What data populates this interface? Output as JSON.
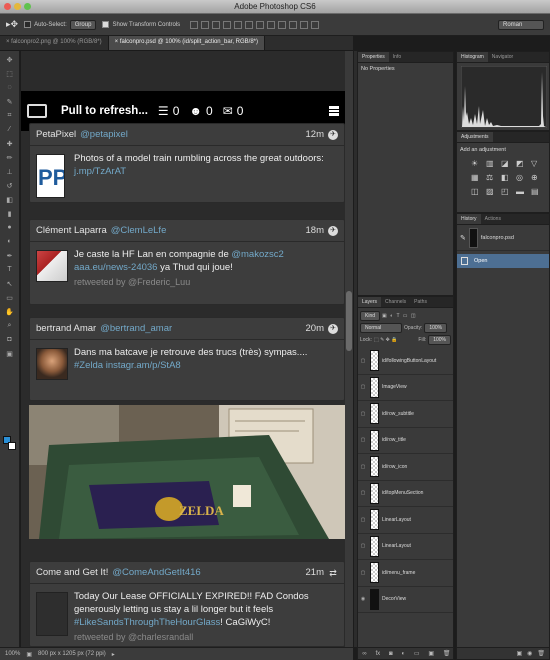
{
  "window": {
    "title": "Adobe Photoshop CS6"
  },
  "options_bar": {
    "auto_select_label": "Auto-Select:",
    "auto_select_value": "Group",
    "show_transform_label": "Show Transform Controls",
    "workspace": "Roman"
  },
  "doc_tabs": [
    "falconpro2.png @ 100% (RGB/8*)",
    "falconpro.psd @ 100% (id/split_action_bar, RGB/8*)"
  ],
  "app": {
    "header": {
      "title": "Pull to refresh...",
      "count1": "0",
      "count2": "0",
      "count3": "0"
    },
    "tweets": [
      {
        "name": "PetaPixel",
        "handle": "@petapixel",
        "time": "12m",
        "text": "Photos of a model train rumbling across the great outdoors:",
        "link": "j.mp/TzArAT",
        "retweet": ""
      },
      {
        "name": "Clément Laparra",
        "handle": "@ClemLeLfe",
        "time": "18m",
        "text_pre": "Je caste la HF Lan en compagnie de",
        "mention": "@makozsc2",
        "link": "aaa.eu/news-24036",
        "text_post": "ya Thud qui joue!",
        "retweet": "retweeted by @Frederic_Luu"
      },
      {
        "name": "bertrand Amar",
        "handle": "@bertrand_amar",
        "time": "20m",
        "text": "Dans ma batcave je retrouve des trucs (très) sympas....",
        "hashtag": "#Zelda",
        "link": "instagr.am/p/StA8",
        "retweet": ""
      },
      {
        "name": "Come and Get It!",
        "handle": "@ComeAndGetIt416",
        "time": "21m",
        "text_a": "Today Our Lease OFFICIALLY EXPIRED!! FAD Condos generously letting us stay a lil longer but it feels",
        "hashtag": "#LikeSandsThroughTheHourGlass",
        "text_b": "! CaGiWyC!",
        "retweet": "retweeted by @charlesrandall"
      }
    ],
    "photo_caption": "ZELDA"
  },
  "panels": {
    "properties": {
      "tabs": [
        "Properties",
        "Info"
      ],
      "empty": "No Properties"
    },
    "histogram": {
      "tabs": [
        "Histogram",
        "Navigator"
      ]
    },
    "adjustments": {
      "tab": "Adjustments",
      "hint": "Add an adjustment"
    },
    "history": {
      "tabs": [
        "History",
        "Actions"
      ],
      "items": [
        "falconpro.psd",
        "Open"
      ]
    },
    "layers": {
      "tabs": [
        "Layers",
        "Channels",
        "Paths"
      ],
      "kind": "Kind",
      "blend": "Normal",
      "opacity_label": "Opacity:",
      "opacity": "100%",
      "lock_label": "Lock:",
      "fill_label": "Fill:",
      "fill": "100%",
      "items": [
        "id/followingButtonLayout",
        "ImageView",
        "id/row_subtitle",
        "id/row_title",
        "id/row_icon",
        "id/topMenuSection",
        "LinearLayout",
        "LinearLayout",
        "id/menu_frame",
        "DecorView"
      ]
    }
  },
  "status": {
    "zoom": "100%",
    "doc_size": "800 px x 1205 px (72 ppi)"
  },
  "colors": {
    "link": "#73a9c9",
    "panel": "#3a3a3a",
    "selected": "#4d6f93"
  }
}
